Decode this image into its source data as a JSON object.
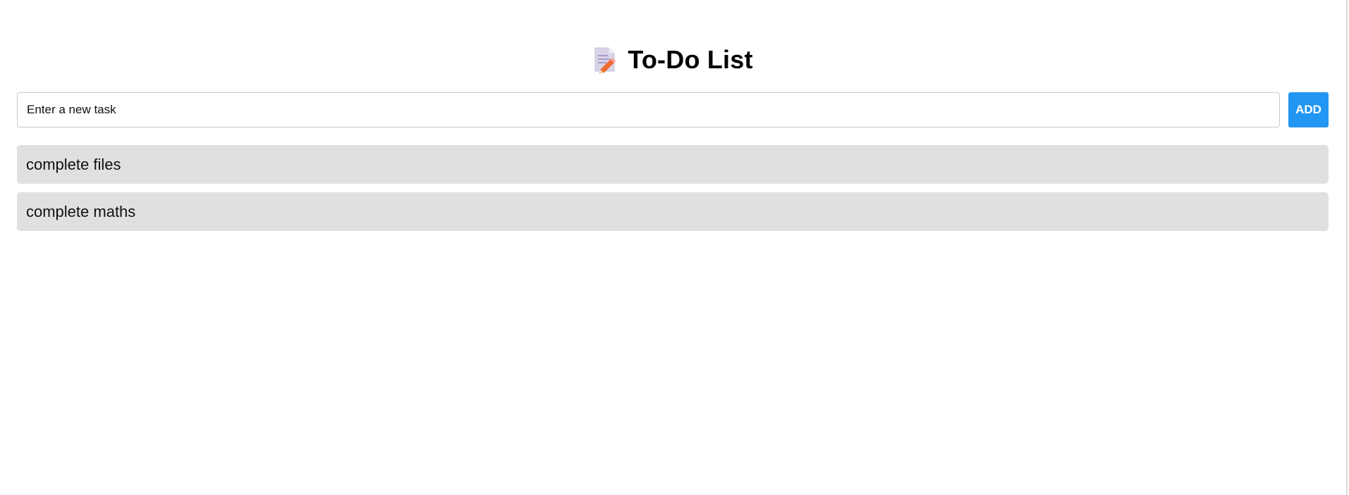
{
  "app": {
    "title": "To-Do List",
    "title_icon": "memo-pencil-icon"
  },
  "input": {
    "value": "",
    "placeholder": "Enter a new task"
  },
  "add_button": {
    "label": "ADD",
    "color": "#2196f3"
  },
  "tasks": [
    {
      "text": "complete files"
    },
    {
      "text": "complete maths"
    }
  ],
  "colors": {
    "task_background": "#e0e0e0",
    "page_background": "#ffffff"
  }
}
